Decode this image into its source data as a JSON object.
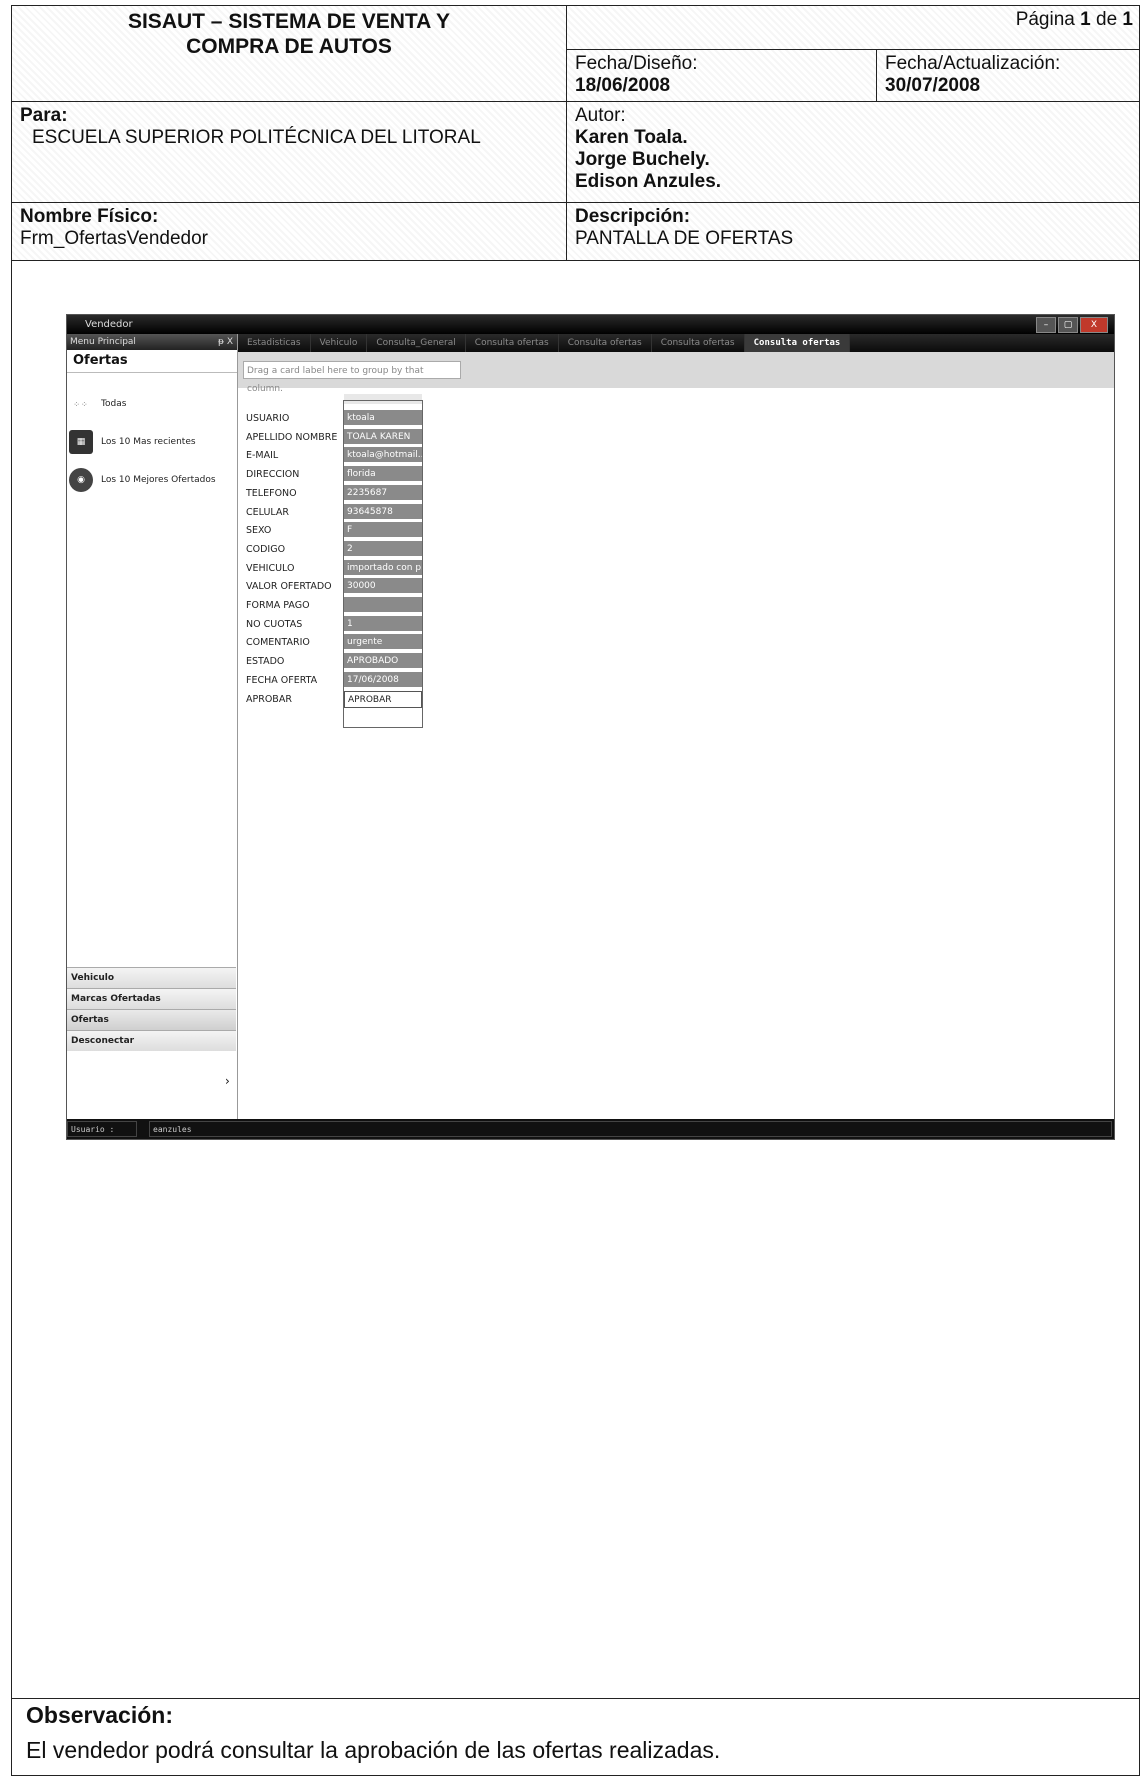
{
  "header": {
    "system_title": "SISAUT – SISTEMA DE VENTA Y COMPRA DE AUTOS",
    "page_label": "Página",
    "page_current": "1",
    "page_of": "de",
    "page_total": "1",
    "fecha_diseno_label": "Fecha/Diseño:",
    "fecha_diseno": "18/06/2008",
    "fecha_actualizacion_label": "Fecha/Actualización:",
    "fecha_actualizacion": "30/07/2008",
    "para_label": "Para:",
    "para": "ESCUELA SUPERIOR POLITÉCNICA DEL LITORAL",
    "autor_label": "Autor:",
    "autores": [
      "Karen Toala.",
      "Jorge Buchely.",
      "Edison Anzules."
    ],
    "nombre_fisico_label": "Nombre Físico:",
    "nombre_fisico": "Frm_OfertasVendedor",
    "descripcion_label": "Descripción:",
    "descripcion": "PANTALLA DE OFERTAS"
  },
  "app": {
    "window_title": "Vendedor",
    "window_buttons": [
      "–",
      "▢",
      "X"
    ],
    "sidebar": {
      "header": "Menu Principal",
      "pin": "ᵽ X",
      "title": "Ofertas",
      "items": [
        {
          "label": "Todas",
          "icon": "grid-icon"
        },
        {
          "label": "Los 10 Mas recientes",
          "icon": "calendar-icon"
        },
        {
          "label": "Los 10 Mejores Ofertados",
          "icon": "users-icon"
        }
      ],
      "nav": [
        "Vehiculo",
        "Marcas Ofertadas",
        "Ofertas",
        "Desconectar"
      ],
      "more": "›"
    },
    "tabs": [
      "Estadisticas",
      "Vehiculo",
      "Consulta_General",
      "Consulta ofertas",
      "Consulta ofertas",
      "Consulta ofertas",
      "Consulta ofertas"
    ],
    "group_hint": "Drag a card label here to group by that column.",
    "fields": [
      {
        "label": "USUARIO",
        "value": "ktoala"
      },
      {
        "label": "APELLIDO NOMBRE",
        "value": "TOALA KAREN"
      },
      {
        "label": "E-MAIL",
        "value": "ktoala@hotmail..."
      },
      {
        "label": "DIRECCION",
        "value": "florida"
      },
      {
        "label": "TELEFONO",
        "value": "2235687"
      },
      {
        "label": "CELULAR",
        "value": "93645878"
      },
      {
        "label": "SEXO",
        "value": "F"
      },
      {
        "label": "CODIGO",
        "value": "2"
      },
      {
        "label": "VEHICULO",
        "value": "importado con p..."
      },
      {
        "label": "VALOR OFERTADO",
        "value": "30000"
      },
      {
        "label": "FORMA PAGO",
        "value": ""
      },
      {
        "label": "NO CUOTAS",
        "value": "1"
      },
      {
        "label": "COMENTARIO",
        "value": "urgente"
      },
      {
        "label": "ESTADO",
        "value": "APROBADO"
      },
      {
        "label": "FECHA OFERTA",
        "value": "17/06/2008"
      },
      {
        "label": "APROBAR",
        "value": "APROBAR"
      }
    ],
    "status": {
      "label": "Usuario :",
      "value": "eanzules"
    }
  },
  "observacion": {
    "label": "Observación:",
    "text": "El vendedor podrá consultar la aprobación de las ofertas realizadas."
  }
}
